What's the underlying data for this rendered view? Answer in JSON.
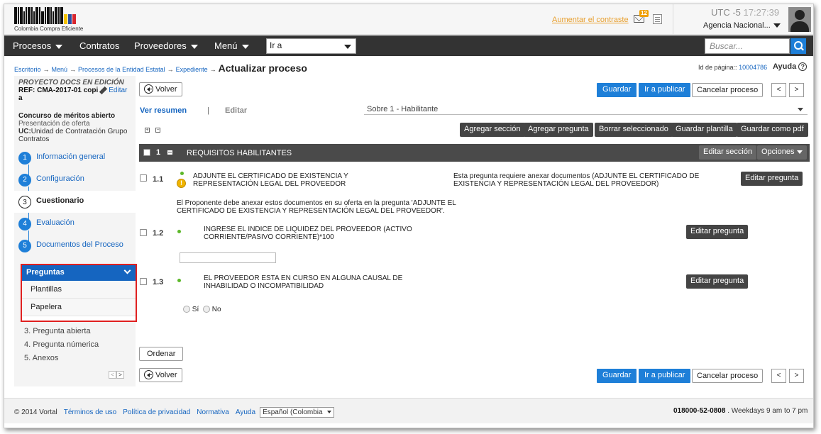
{
  "header": {
    "logo_text": "Colombia Compra Eficiente",
    "contrast_link": "Aumentar el contraste",
    "mail_count": "12",
    "utc_label": "UTC -5",
    "utc_time": "17:27:39",
    "agency": "Agencia Nacional..."
  },
  "nav": {
    "procesos": "Procesos",
    "contratos": "Contratos",
    "proveedores": "Proveedores",
    "menu": "Menú",
    "ira": "Ir a",
    "search_placeholder": "Buscar..."
  },
  "breadcrumb": {
    "items": [
      "Escritorio",
      "Menú",
      "Procesos de la Entidad Estatal",
      "Expediente"
    ],
    "current": "Actualizar proceso",
    "page_id_label": "Id de página::",
    "page_id": "10004786",
    "help": "Ayuda"
  },
  "project": {
    "status": "PROYECTO DOCS EN EDICIÓN",
    "ref": "REF: CMA-2017-01 copi",
    "ref2": "a",
    "edit": "Editar",
    "type": "Concurso de méritos abierto",
    "phase": "Presentación de oferta",
    "uc_label": "UC:",
    "uc_value": "Unidad de Contratación Grupo Contratos"
  },
  "steps": [
    {
      "num": "1",
      "label": "Información general"
    },
    {
      "num": "2",
      "label": "Configuración"
    },
    {
      "num": "3",
      "label": "Cuestionario"
    },
    {
      "num": "4",
      "label": "Evaluación"
    },
    {
      "num": "5",
      "label": "Documentos del Proceso"
    }
  ],
  "preguntas_menu": {
    "title": "Preguntas",
    "items": [
      "Plantillas",
      "Papelera"
    ]
  },
  "question_types": [
    "3. Pregunta abierta",
    "4. Pregunta númerica",
    "5. Anexos"
  ],
  "toolbar": {
    "volver": "Volver",
    "guardar": "Guardar",
    "ir_publicar": "Ir a publicar",
    "cancelar": "Cancelar proceso",
    "prev": "<",
    "next": ">",
    "ordenar": "Ordenar"
  },
  "tabs": {
    "resumen": "Ver resumen",
    "sep": "|",
    "editar": "Editar",
    "sobre": "Sobre 1 - Habilitante"
  },
  "actions": {
    "agregar_seccion": "Agregar sección",
    "agregar_pregunta": "Agregar pregunta",
    "borrar": "Borrar seleccionado",
    "guardar_plantilla": "Guardar plantilla",
    "guardar_pdf": "Guardar como pdf"
  },
  "section": {
    "num": "1",
    "title": "REQUISITOS HABILITANTES",
    "editar": "Editar sección",
    "opciones": "Opciones"
  },
  "questions": [
    {
      "num": "1.1",
      "text": "ADJUNTE EL CERTIFICADO DE EXISTENCIA Y REPRESENTACIÓN LEGAL DEL PROVEEDOR",
      "info": "Esta pregunta requiere anexar documentos (ADJUNTE EL CERTIFICADO DE EXISTENCIA Y REPRESENTACIÓN LEGAL DEL PROVEEDOR)",
      "note": "El Proponente debe anexar estos documentos en su oferta en la pregunta 'ADJUNTE EL CERTIFICADO DE EXISTENCIA Y REPRESENTACIÓN LEGAL DEL PROVEEDOR'."
    },
    {
      "num": "1.2",
      "text": "INGRESE EL INDICE DE LIQUIDEZ DEL PROVEEDOR (ACTIVO CORRIENTE/PASIVO CORRIENTE)*100"
    },
    {
      "num": "1.3",
      "text": "EL PROVEEDOR ESTA EN CURSO EN ALGUNA CAUSAL DE INHABILIDAD O INCOMPATIBILIDAD",
      "options": [
        "Sí",
        "No"
      ]
    }
  ],
  "edit_question": "Editar pregunta",
  "footer": {
    "copyright": "© 2014 Vortal",
    "links": [
      "Términos de uso",
      "Política de privacidad",
      "Normativa",
      "Ayuda"
    ],
    "language": "Español (Colombia",
    "phone": "018000-52-0808",
    "hours": ". Weekdays 9 am to 7 pm"
  }
}
